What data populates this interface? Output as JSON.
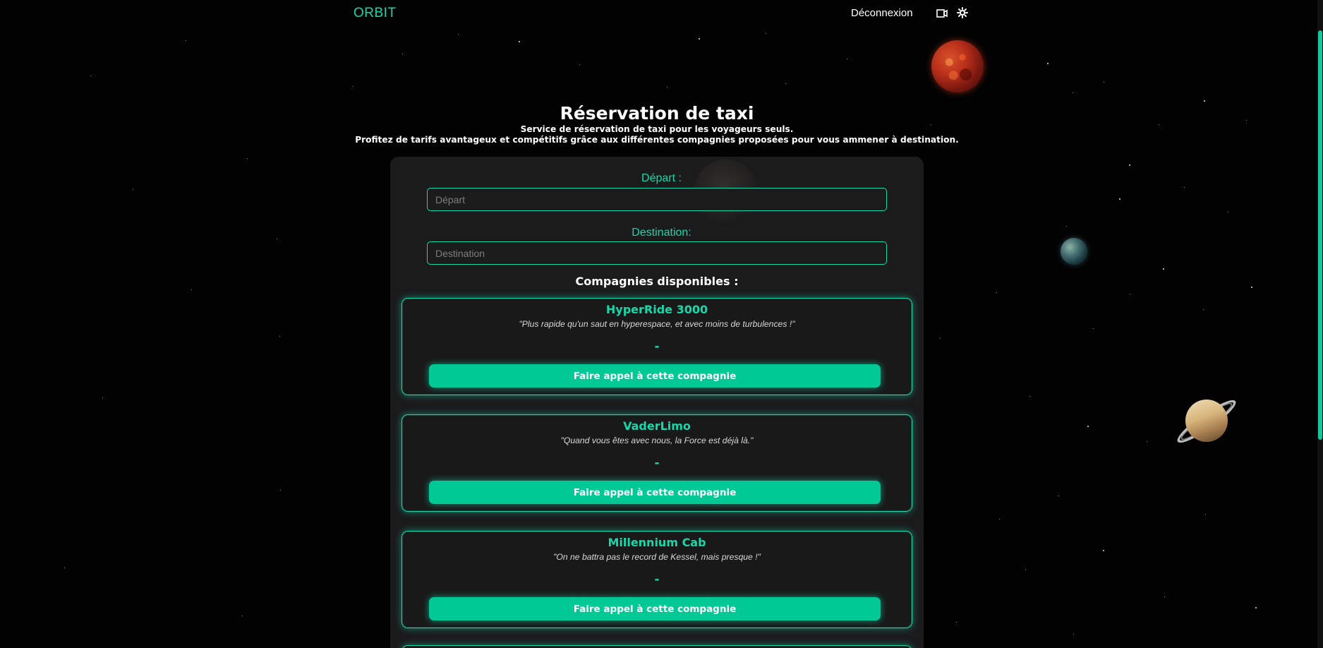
{
  "app": {
    "brand": "ORBIT",
    "logout_label": "Déconnexion"
  },
  "header": {
    "icons": [
      "camera-icon",
      "gear-icon"
    ]
  },
  "main": {
    "title": "Réservation de taxi",
    "subtitle_line1": "Service de réservation de taxi pour les voyageurs seuls.",
    "subtitle_line2": "Profitez de tarifs avantageux et compétitifs grâce aux différentes compagnies proposées pour vous ammener à destination."
  },
  "form": {
    "departure_label": "Départ :",
    "departure_placeholder": "Départ",
    "destination_label": "Destination:",
    "destination_placeholder": "Destination",
    "companies_title": "Compagnies disponibles :"
  },
  "companies": [
    {
      "name": "HyperRide 3000",
      "tagline": "\"Plus rapide qu'un saut en hyperespace, et avec moins de turbulences !\"",
      "price": "-",
      "button_label": "Faire appel à cette compagnie"
    },
    {
      "name": "VaderLimo",
      "tagline": "\"Quand vous êtes avec nous, la Force est déjà là.\"",
      "price": "-",
      "button_label": "Faire appel à cette compagnie"
    },
    {
      "name": "Millennium Cab",
      "tagline": "\"On ne battra pas le record de Kessel, mais presque !\"",
      "price": "-",
      "button_label": "Faire appel à cette compagnie"
    }
  ],
  "colors": {
    "accent": "#16d8aa",
    "button": "#00c996",
    "background": "#020203",
    "panel": "#1c1c1d"
  }
}
